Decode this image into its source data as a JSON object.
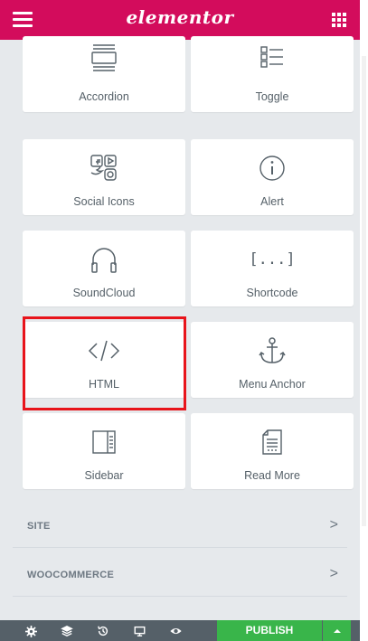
{
  "header": {
    "logo": "elementor"
  },
  "widgets": [
    {
      "label": "Accordion",
      "icon": "accordion-icon"
    },
    {
      "label": "Toggle",
      "icon": "toggle-icon"
    },
    {
      "label": "Social Icons",
      "icon": "social-icons-icon"
    },
    {
      "label": "Alert",
      "icon": "alert-icon"
    },
    {
      "label": "SoundCloud",
      "icon": "soundcloud-icon"
    },
    {
      "label": "Shortcode",
      "icon": "shortcode-icon",
      "glyph": "[...]"
    },
    {
      "label": "HTML",
      "icon": "html-icon"
    },
    {
      "label": "Menu Anchor",
      "icon": "anchor-icon"
    },
    {
      "label": "Sidebar",
      "icon": "sidebar-icon"
    },
    {
      "label": "Read More",
      "icon": "read-more-icon"
    }
  ],
  "sections": [
    {
      "title": "SITE",
      "chevron": ">"
    },
    {
      "title": "WOOCOMMERCE",
      "chevron": ">"
    }
  ],
  "footer": {
    "publish_label": "PUBLISH",
    "icons": [
      "settings-icon",
      "navigator-icon",
      "history-icon",
      "responsive-icon",
      "preview-icon",
      "caret-up-icon"
    ]
  },
  "colors": {
    "brand": "#d30c5c",
    "publish": "#39b54a",
    "panel_bg": "#e6e9ec",
    "footer_bg": "#556068",
    "highlight": "#e8141b"
  }
}
